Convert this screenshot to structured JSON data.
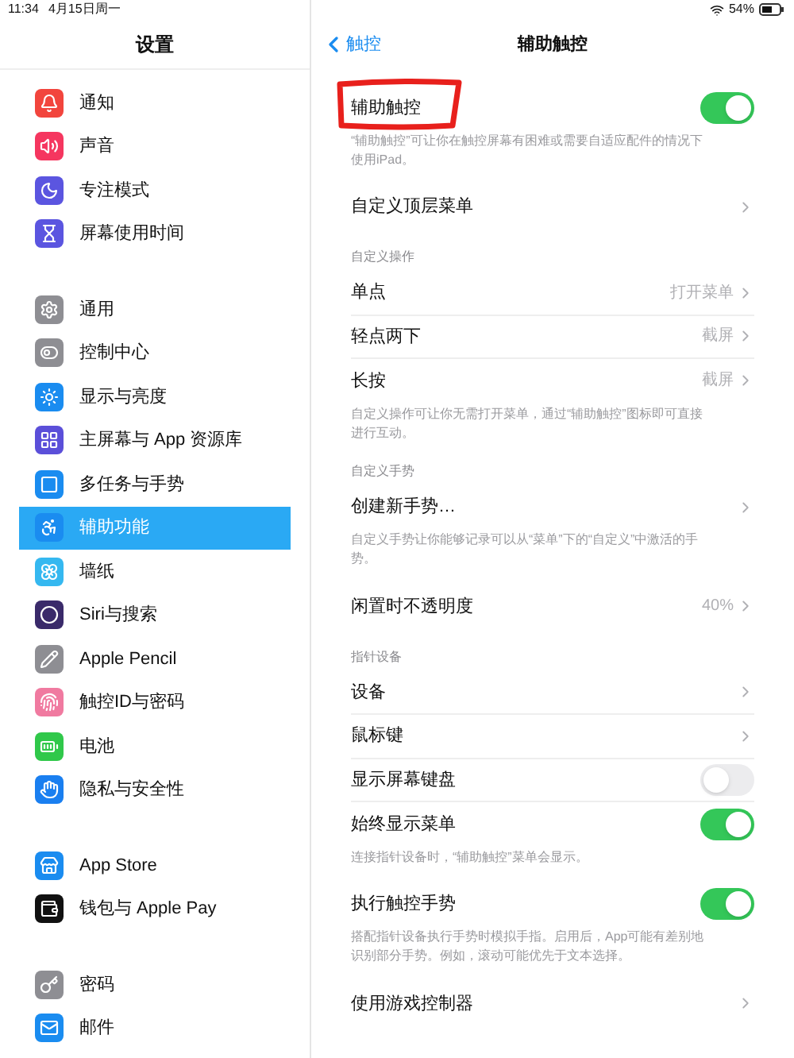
{
  "status_bar": {
    "time": "11:34",
    "date": "4月15日周一",
    "battery": "54%"
  },
  "sidebar": {
    "title": "设置",
    "groups": [
      [
        {
          "label": "通知",
          "color": "#f2453d",
          "selected": false
        },
        {
          "label": "声音",
          "color": "#f5365f",
          "selected": false
        },
        {
          "label": "专注模式",
          "color": "#5b55e0",
          "selected": false
        },
        {
          "label": "屏幕使用时间",
          "color": "#5b55e0",
          "selected": false
        }
      ],
      [
        {
          "label": "通用",
          "color": "#8e8e93",
          "selected": false
        },
        {
          "label": "控制中心",
          "color": "#8e8e93",
          "selected": false
        },
        {
          "label": "显示与亮度",
          "color": "#1a8cf0",
          "selected": false
        },
        {
          "label": "主屏幕与 App 资源库",
          "color": "#5b4fd9",
          "selected": false
        },
        {
          "label": "多任务与手势",
          "color": "#1a8cf0",
          "selected": false
        },
        {
          "label": "辅助功能",
          "color": "#1a8cf0",
          "selected": true
        },
        {
          "label": "墙纸",
          "color": "#35b8f0",
          "selected": false
        },
        {
          "label": "Siri与搜索",
          "color": "#3a2a6a",
          "selected": false
        },
        {
          "label": "Apple Pencil",
          "color": "#8e8e93",
          "selected": false
        },
        {
          "label": "触控ID与密码",
          "color": "#f07aa0",
          "selected": false
        },
        {
          "label": "电池",
          "color": "#30c84a",
          "selected": false
        },
        {
          "label": "隐私与安全性",
          "color": "#1a7ff0",
          "selected": false
        }
      ],
      [
        {
          "label": "App Store",
          "color": "#1a8cf0",
          "selected": false
        },
        {
          "label": "钱包与 Apple Pay",
          "color": "#111111",
          "selected": false
        }
      ],
      [
        {
          "label": "密码",
          "color": "#8e8e93",
          "selected": false
        },
        {
          "label": "邮件",
          "color": "#1a8cf0",
          "selected": false
        }
      ]
    ]
  },
  "detail": {
    "back": "触控",
    "title": "辅助触控",
    "groups": [
      {
        "rows": [
          {
            "kind": "toggle",
            "label": "辅助触控",
            "on": true,
            "annotated": true
          }
        ],
        "footer": "“辅助触控”可让你在触控屏幕有困难或需要自适应配件的情况下使用iPad。"
      },
      {
        "rows": [
          {
            "kind": "link",
            "label": "自定义顶层菜单"
          }
        ]
      },
      {
        "header": "自定义操作",
        "rows": [
          {
            "kind": "link",
            "label": "单点",
            "value": "打开菜单"
          },
          {
            "kind": "link",
            "label": "轻点两下",
            "value": "截屏"
          },
          {
            "kind": "link",
            "label": "长按",
            "value": "截屏"
          }
        ],
        "footer": "自定义操作可让你无需打开菜单，通过“辅助触控”图标即可直接进行互动。"
      },
      {
        "header": "自定义手势",
        "rows": [
          {
            "kind": "link",
            "label": "创建新手势…"
          }
        ],
        "footer": "自定义手势让你能够记录可以从“菜单”下的“自定义”中激活的手势。"
      },
      {
        "rows": [
          {
            "kind": "link",
            "label": "闲置时不透明度",
            "value": "40%"
          }
        ]
      },
      {
        "header": "指针设备",
        "rows": [
          {
            "kind": "link",
            "label": "设备"
          },
          {
            "kind": "link",
            "label": "鼠标键"
          },
          {
            "kind": "toggle",
            "label": "显示屏幕键盘",
            "on": false
          },
          {
            "kind": "toggle",
            "label": "始终显示菜单",
            "on": true
          }
        ],
        "footer": "连接指针设备时，“辅助触控”菜单会显示。"
      },
      {
        "rows": [
          {
            "kind": "toggle",
            "label": "执行触控手势",
            "on": true
          }
        ],
        "footer": "搭配指针设备执行手势时模拟手指。启用后，App可能有差别地识别部分手势。例如，滚动可能优先于文本选择。"
      },
      {
        "rows": [
          {
            "kind": "link",
            "label": "使用游戏控制器"
          }
        ]
      }
    ]
  }
}
